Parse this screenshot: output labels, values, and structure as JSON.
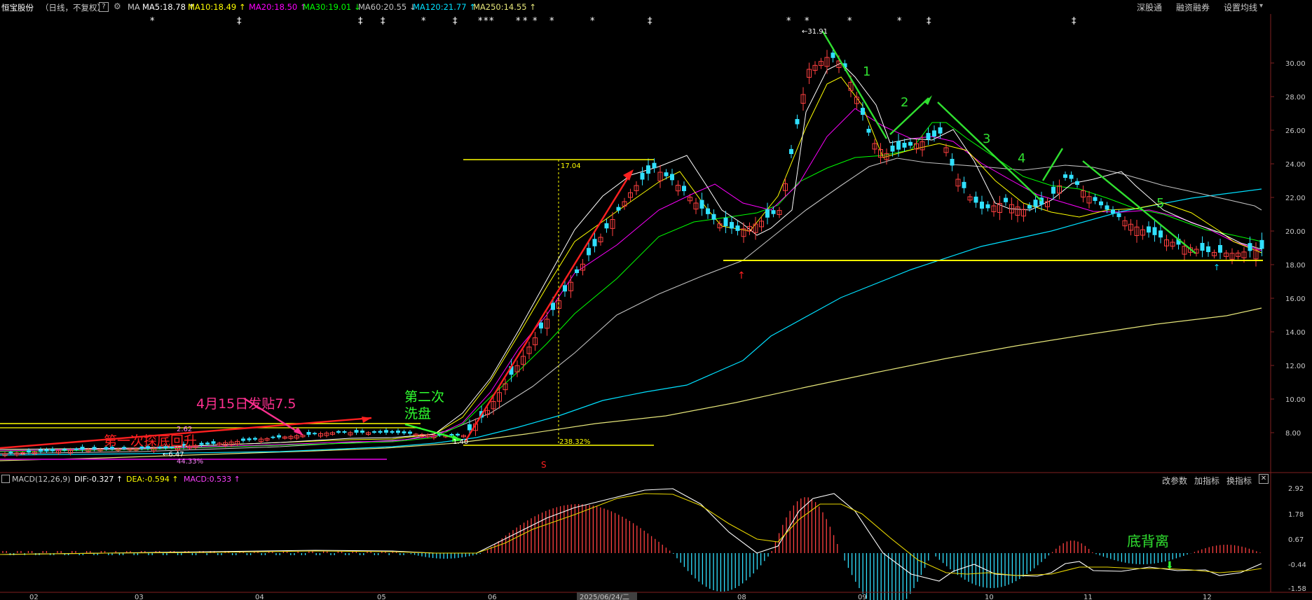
{
  "header": {
    "stock_name": "恒宝股份",
    "period": "（日线，不复权）",
    "help_icon": "?",
    "settings_icon": "gear-icon",
    "ma_label": "MA",
    "ma_values": [
      {
        "label": "MA5:18.78",
        "arrow": "↑",
        "color": "#ffffff"
      },
      {
        "label": "MA10:18.49",
        "arrow": "↑",
        "color": "#ffff00"
      },
      {
        "label": "MA20:18.50",
        "arrow": "↑",
        "color": "#ff00ff"
      },
      {
        "label": "MA30:19.01",
        "arrow": "↓",
        "color": "#00ff00"
      },
      {
        "label": "MA60:20.55",
        "arrow": "↓",
        "color": "#c0c0c0"
      },
      {
        "label": "MA120:21.77",
        "arrow": "↑",
        "color": "#00e0ff"
      },
      {
        "label": "MA250:14.55",
        "arrow": "↑",
        "color": "#e6e67a"
      }
    ],
    "right_buttons": [
      "深股通",
      "融资融券",
      "设置均线"
    ]
  },
  "chart_data": {
    "type": "candlestick",
    "y_ticks": [
      "30.00",
      "28.00",
      "26.00",
      "24.00",
      "22.00",
      "20.00",
      "18.00",
      "16.00",
      "14.00",
      "12.00",
      "10.00",
      "8.00"
    ],
    "x_ticks": [
      "02",
      "03",
      "04",
      "05",
      "06",
      "2025/06/24/二",
      "08",
      "09",
      "10",
      "11",
      "12"
    ],
    "high_marker": "31.91",
    "low_marker": "6.47",
    "fib_labels": [
      "17.04",
      "238.32%",
      "2.62",
      "1.40",
      "44.33%"
    ],
    "annotations": {
      "label_0415": "4月15日发贴7.5",
      "label_first": "第一次探底回升",
      "label_second_l1": "第二次",
      "label_second_l2": "洗盘",
      "wave_nums": [
        "1",
        "2",
        "3",
        "4",
        "5"
      ],
      "signal_s": "S",
      "divergence": "底背离"
    }
  },
  "macd": {
    "title": "MACD(12,26,9)",
    "dif": "DIF:-0.327",
    "dea": "DEA:-0.594",
    "macd": "MACD:0.533",
    "buttons": [
      "改参数",
      "加指标",
      "换指标"
    ],
    "y_ticks": [
      "2.92",
      "1.78",
      "0.67",
      "-0.44",
      "-1.58"
    ]
  }
}
